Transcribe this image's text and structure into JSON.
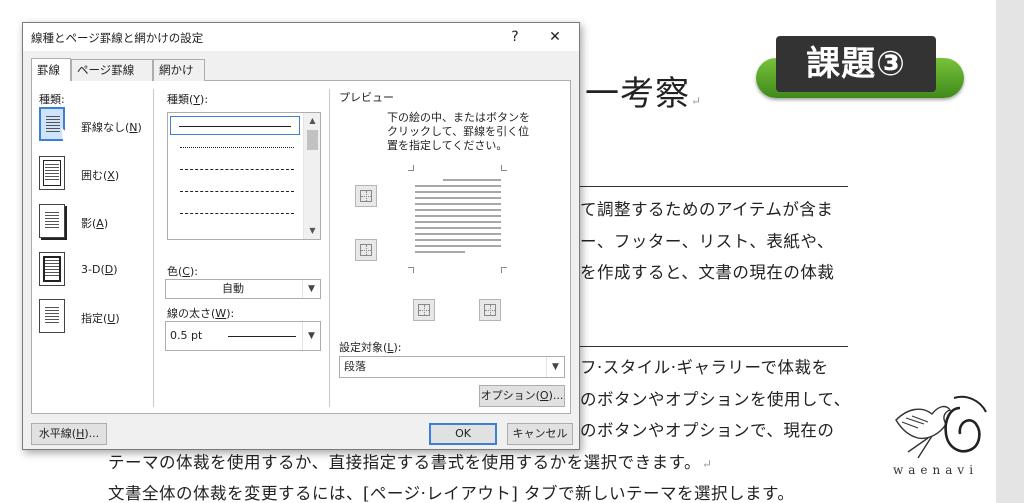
{
  "document": {
    "title": "一考察",
    "para_mark": "↵",
    "lines_right": [
      "て調整するためのアイテムが含ま",
      "ー、フッター、リスト、表紙や、",
      "を作成すると、文書の現在の体裁",
      "フ·スタイル·ギャラリーで体裁を",
      "のボタンやオプションを使用して、",
      "のボタンやオプションで、現在の"
    ],
    "lines_full": [
      "テーマの体裁を使用するか、直接指定する書式を使用するかを選択できます。",
      "文書全体の体裁を変更するには、[ページ·レイアウト] タブで新しいテーマを選択します。"
    ],
    "badge": "課題③",
    "logo_text": "waenavi"
  },
  "dialog": {
    "title": "線種とページ罫線と網かけの設定",
    "help": "?",
    "close": "✕",
    "tabs": [
      "罫線",
      "ページ罫線",
      "網かけ"
    ],
    "setting": {
      "label": "種類:",
      "items": [
        {
          "label": "罫線なし(",
          "key": "N",
          "suffix": ")"
        },
        {
          "label": "囲む(",
          "key": "X",
          "suffix": ")"
        },
        {
          "label": "影(",
          "key": "A",
          "suffix": ")"
        },
        {
          "label": "3-D(",
          "key": "D",
          "suffix": ")"
        },
        {
          "label": "指定(",
          "key": "U",
          "suffix": ")"
        }
      ]
    },
    "style": {
      "label": "種類(",
      "key": "Y",
      "suffix": "):"
    },
    "color": {
      "label": "色(",
      "key": "C",
      "suffix": "):",
      "value": "自動"
    },
    "width": {
      "label": "線の太さ(",
      "key": "W",
      "suffix": "):",
      "value": "0.5 pt"
    },
    "preview": {
      "label": "プレビュー",
      "instruction_1": "下の絵の中、またはボタンを",
      "instruction_2": "クリックして、罫線を引く位",
      "instruction_3": "置を指定してください。"
    },
    "apply_to": {
      "label": "設定対象(",
      "key": "L",
      "suffix": "):",
      "value": "段落"
    },
    "options_button": {
      "label": "オプション(",
      "key": "O",
      "suffix": ")..."
    },
    "horizontal_line_button": {
      "label": "水平線(",
      "key": "H",
      "suffix": ")..."
    },
    "ok_button": "OK",
    "cancel_button": "キャンセル"
  },
  "colors": {
    "badge_green": "#5aa82a",
    "accent_blue": "#3b7fd6"
  }
}
